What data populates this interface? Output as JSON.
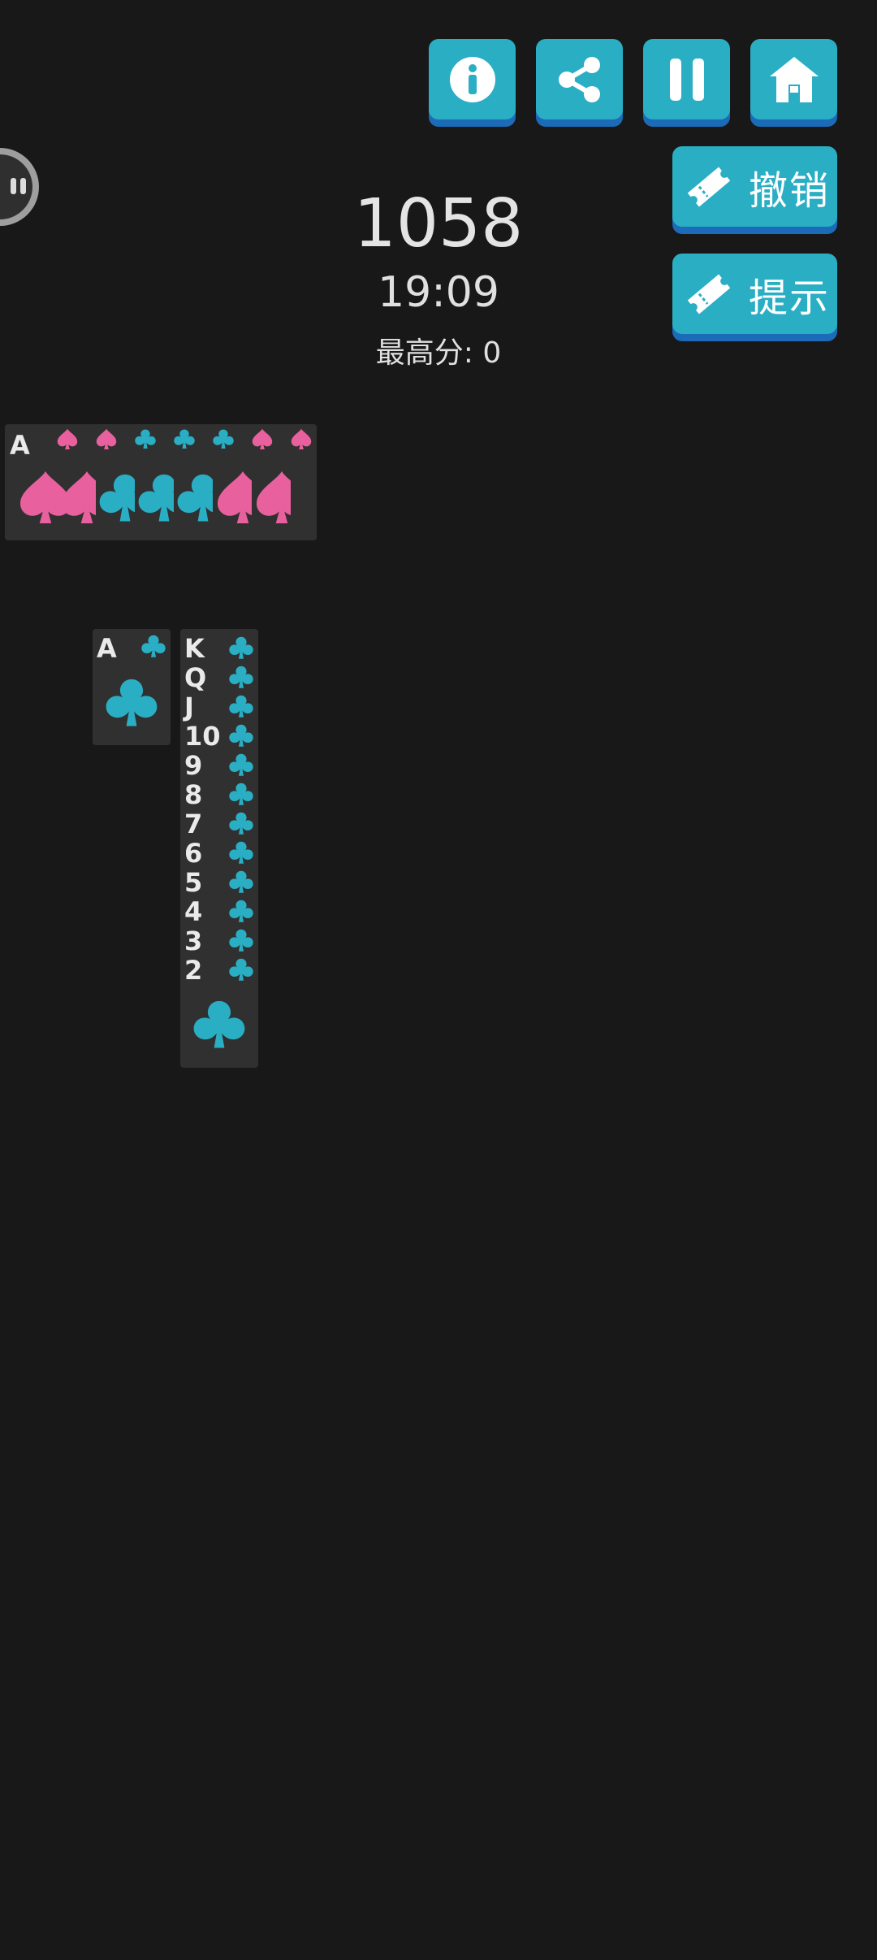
{
  "header": {
    "buttons": [
      {
        "name": "info-button",
        "icon": "info-icon"
      },
      {
        "name": "share-button",
        "icon": "share-icon"
      },
      {
        "name": "pause-button",
        "icon": "pause-icon"
      },
      {
        "name": "home-button",
        "icon": "home-icon"
      }
    ],
    "undo_label": "撤销",
    "hint_label": "提示"
  },
  "stats": {
    "score": "1058",
    "time": "19:09",
    "best_score_label": "最高分:  0"
  },
  "colors": {
    "background": "#181818",
    "button": "#2aaec4",
    "button_shadow": "#1b6bb8",
    "card": "#303030",
    "spade": "#e8609e",
    "club": "#2aaec4"
  },
  "completed_stack": {
    "top_rank": "A",
    "suits": [
      "spade",
      "spade",
      "club",
      "club",
      "club",
      "spade",
      "spade"
    ]
  },
  "tableau": {
    "column1": {
      "rank": "A",
      "suit": "club"
    },
    "column2": {
      "ranks": [
        "K",
        "Q",
        "J",
        "10",
        "9",
        "8",
        "7",
        "6",
        "5",
        "4",
        "3",
        "2"
      ],
      "suit": "club"
    }
  }
}
